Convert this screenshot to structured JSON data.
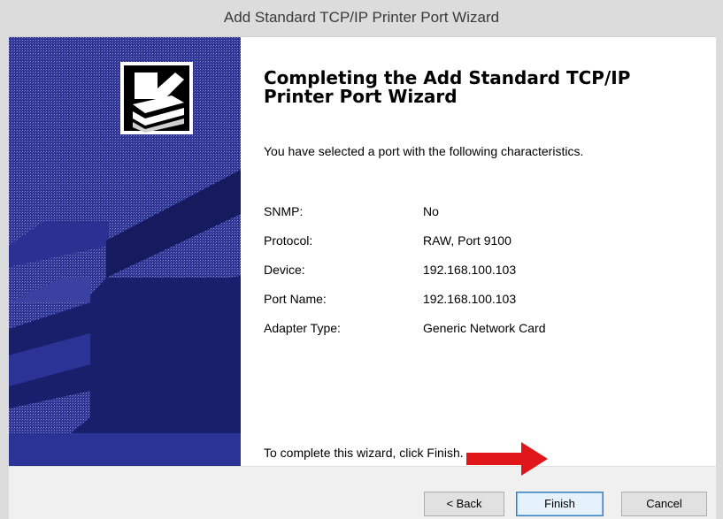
{
  "window": {
    "title": "Add Standard TCP/IP Printer Port Wizard"
  },
  "page": {
    "heading": "Completing the Add Standard TCP/IP Printer Port Wizard",
    "intro": "You have selected a port with the following characteristics.",
    "properties": [
      {
        "label": "SNMP:",
        "value": "No"
      },
      {
        "label": "Protocol:",
        "value": "RAW, Port 9100"
      },
      {
        "label": "Device:",
        "value": "192.168.100.103"
      },
      {
        "label": "Port Name:",
        "value": "192.168.100.103"
      },
      {
        "label": "Adapter Type:",
        "value": "Generic Network Card"
      }
    ],
    "outro": "To complete this wizard, click Finish."
  },
  "buttons": {
    "back": "< Back",
    "finish": "Finish",
    "cancel": "Cancel"
  },
  "colors": {
    "banner_dark": "#1a1f6b",
    "banner_mid": "#2d3593",
    "annotation_arrow": "#e0161b"
  },
  "icons": {
    "banner": "printer-wizard-icon",
    "annotation": "red-arrow-icon"
  }
}
